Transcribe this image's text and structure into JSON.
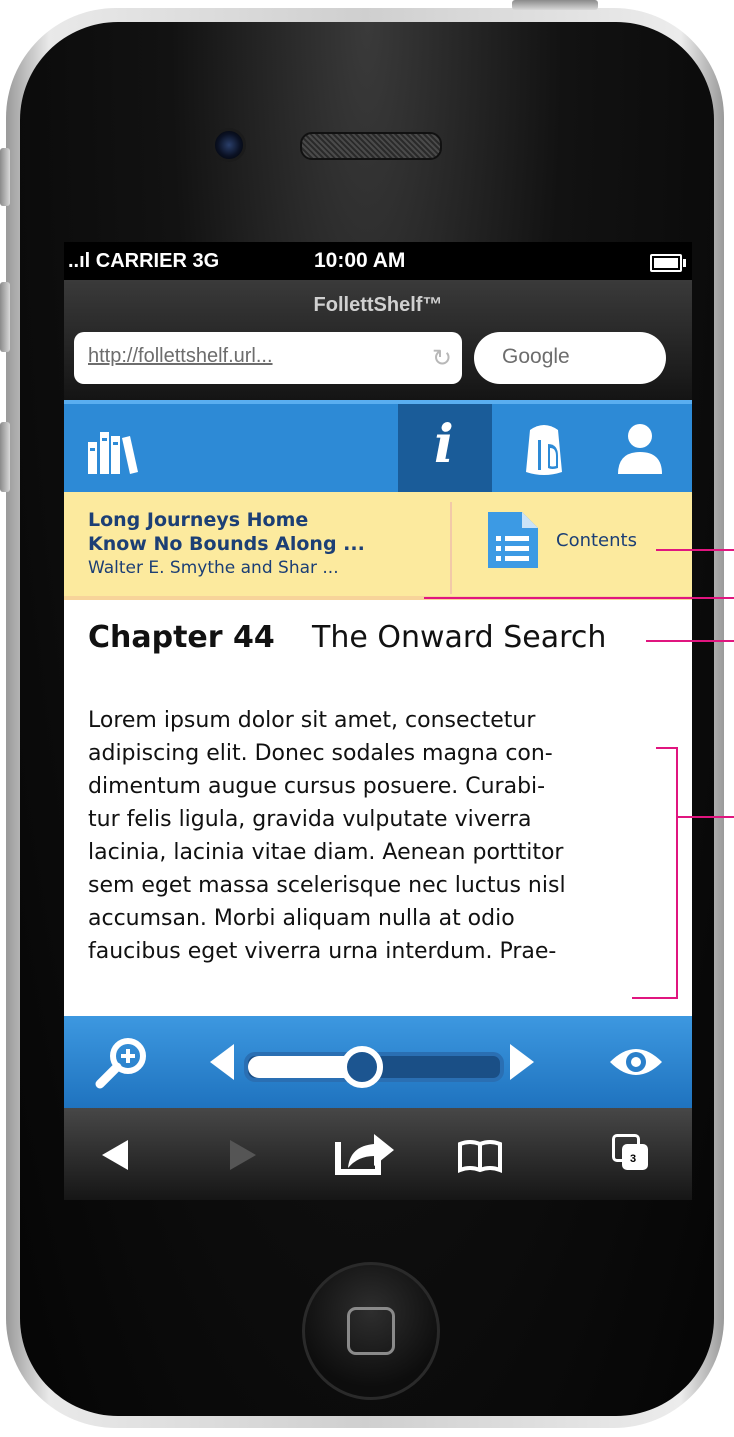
{
  "status": {
    "carrier": "..ıl CARRIER 3G",
    "time": "10:00 AM"
  },
  "browser": {
    "page_title": "FollettShelf™",
    "url": "http://follettshelf.url...",
    "search_placeholder": "Google"
  },
  "appnav": {
    "items": [
      {
        "name": "bookshelf-icon",
        "active": false
      },
      {
        "name": "info-icon",
        "active": true,
        "glyph": "i"
      },
      {
        "name": "backpack-icon",
        "active": false
      },
      {
        "name": "profile-icon",
        "active": false
      }
    ]
  },
  "book": {
    "title_line1": "Long Journeys Home",
    "title_line2": "Know No Bounds Along ...",
    "author": "Walter E. Smythe and Shar ...",
    "contents_label": "Contents"
  },
  "chapter": {
    "number": "Chapter 44",
    "title": "The Onward Search",
    "lines": [
      "Lorem ipsum dolor sit amet, consectetur",
      "adipiscing elit. Donec sodales magna con-",
      "dimentum augue cursus posuere. Curabi-",
      "tur felis ligula, gravida vulputate viverra",
      "lacinia, lacinia vitae diam. Aenean porttitor",
      "sem eget massa scelerisque nec luctus nisl",
      "accumsan. Morbi aliquam nulla at odio",
      "faucibus eget viverra urna interdum. Prae-"
    ]
  },
  "reader": {
    "progress": 0.45
  },
  "safari": {
    "tab_count": "3"
  },
  "colors": {
    "nav_blue": "#2d8ad6",
    "nav_active": "#1a5c99",
    "book_bg": "#fcea9e",
    "book_text": "#1c3f75",
    "annotation": "#e0157f"
  }
}
